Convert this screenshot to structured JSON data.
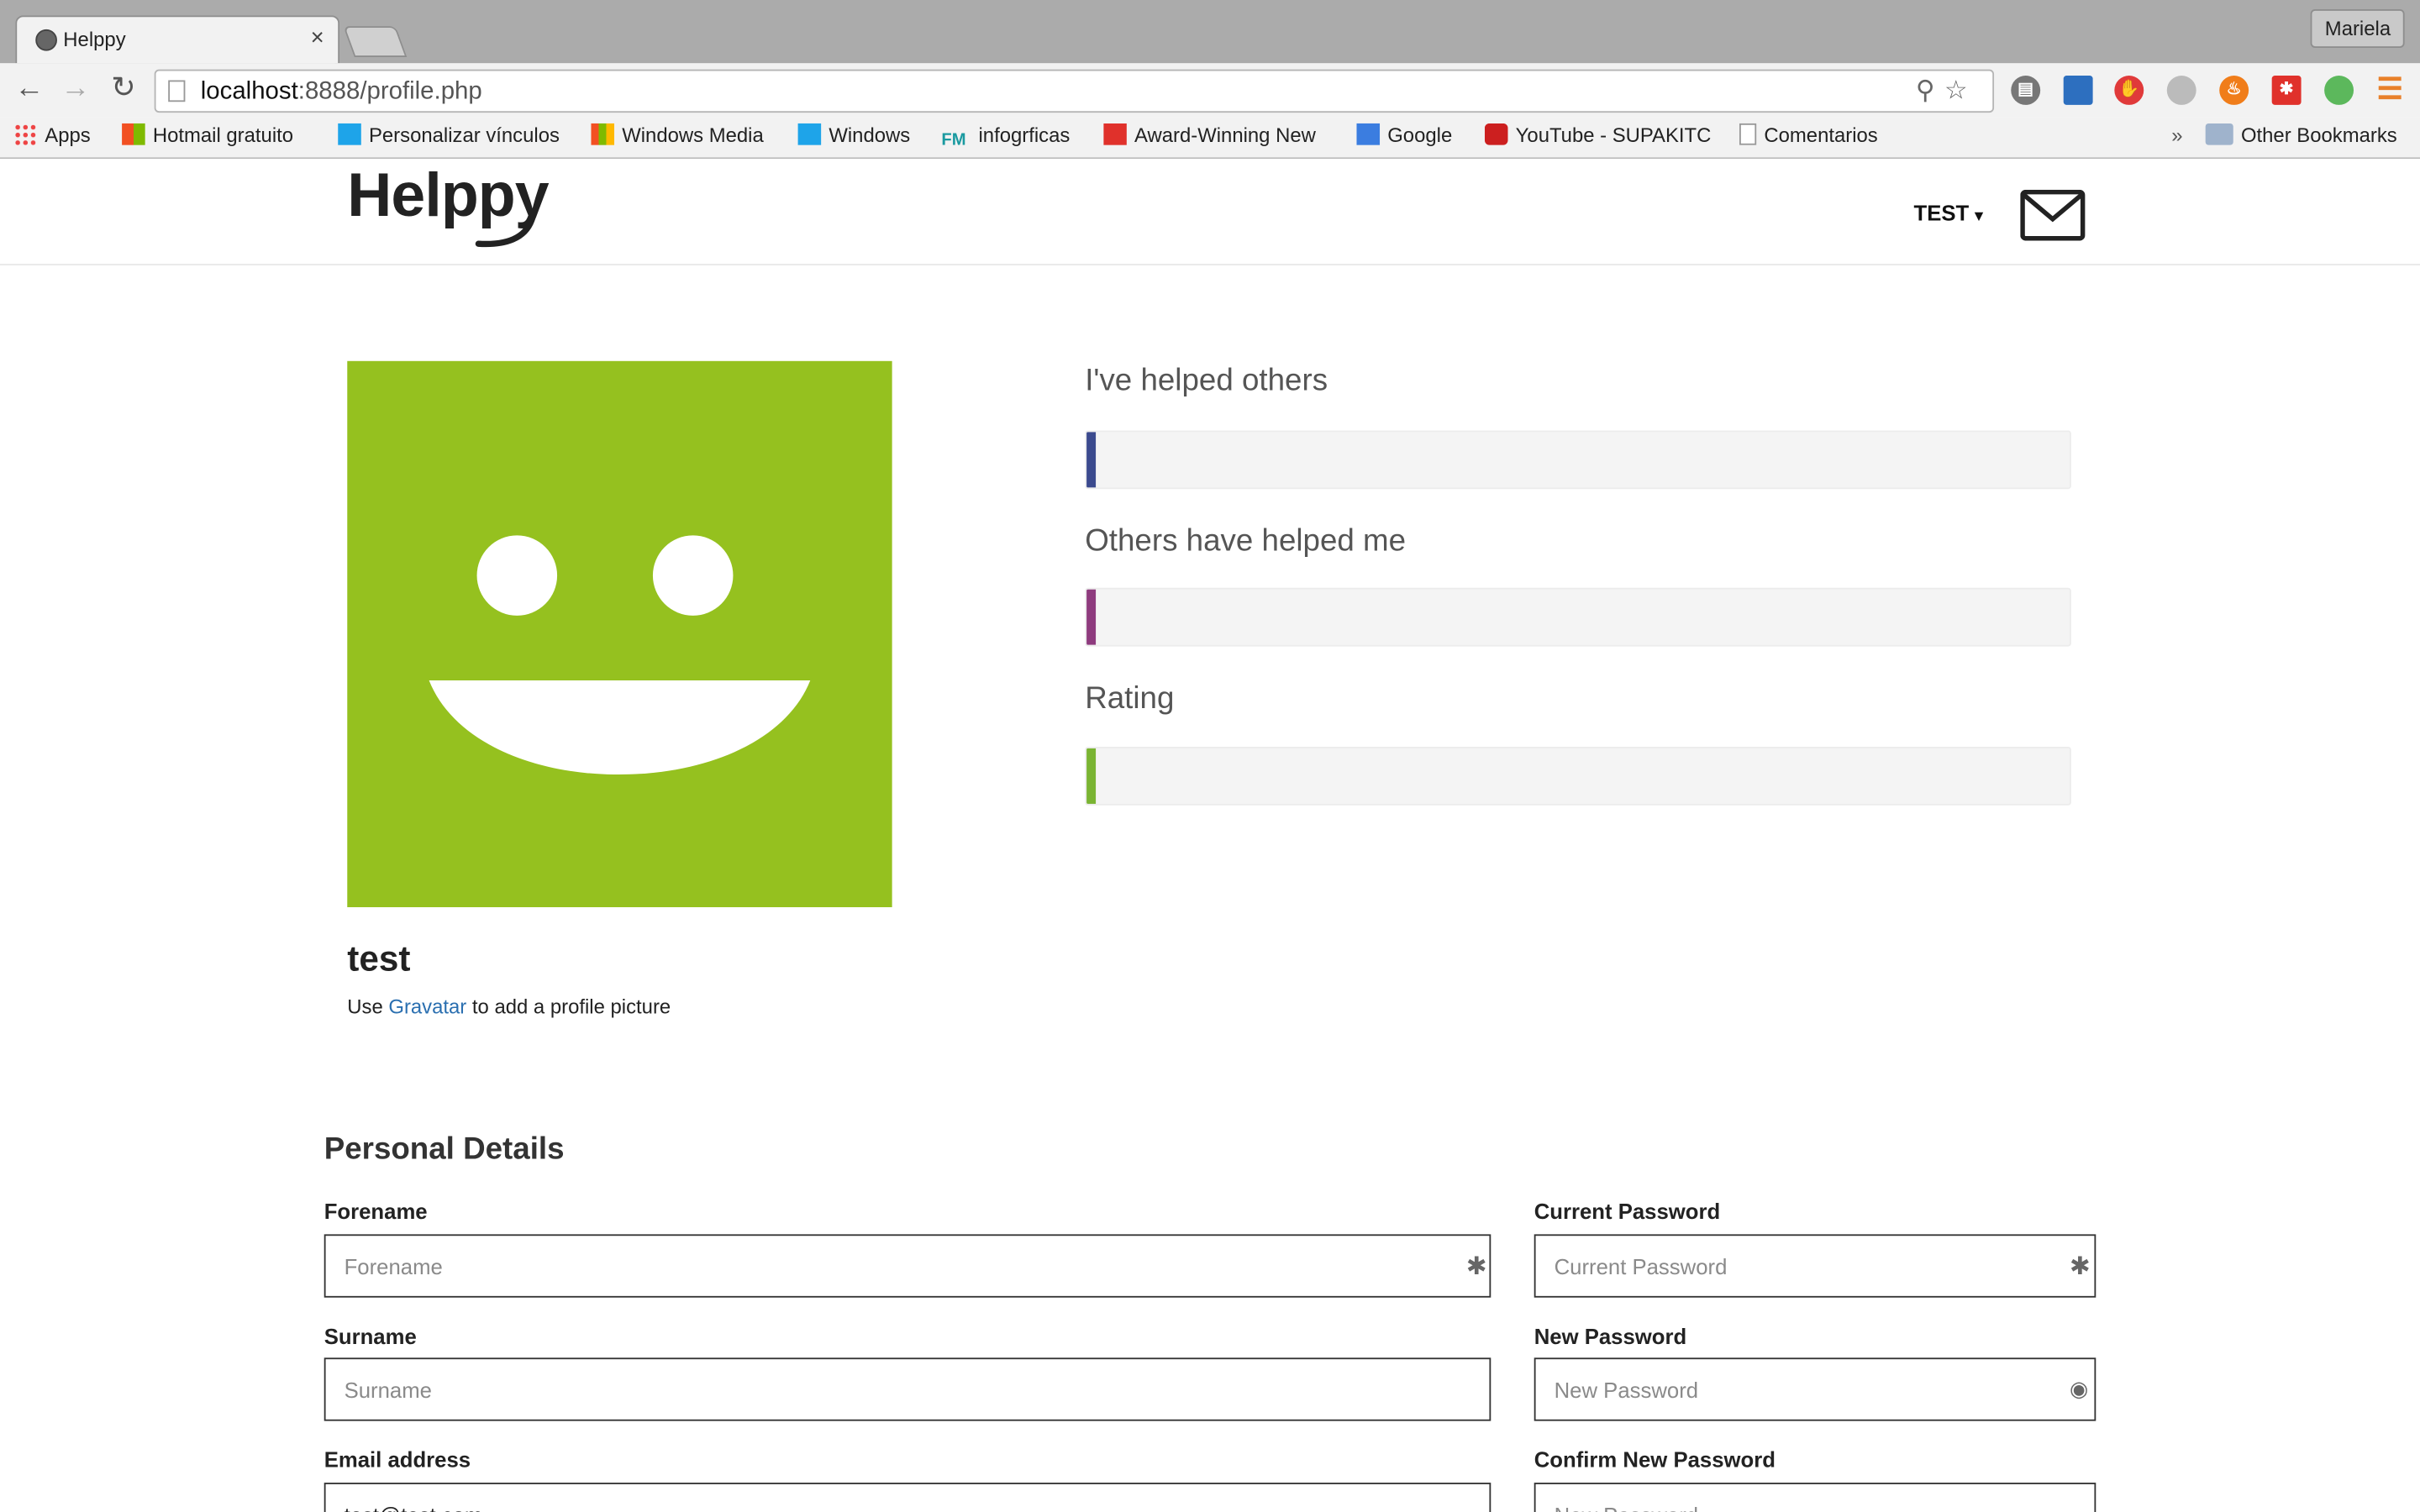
{
  "browser": {
    "tab_title": "Helppy",
    "profile_button": "Mariela",
    "url_host": "localhost",
    "url_rest": ":8888/profile.php",
    "bookmarks": [
      {
        "label": "Apps",
        "icon": "apps-grid-icon"
      },
      {
        "label": "Hotmail gratuito",
        "icon": "windows-icon"
      },
      {
        "label": "Personalizar vínculos",
        "icon": "windows-icon"
      },
      {
        "label": "Windows Media",
        "icon": "windows-icon"
      },
      {
        "label": "Windows",
        "icon": "windows-icon"
      },
      {
        "label": "infogrficas",
        "icon": "fm-icon"
      },
      {
        "label": "Award-Winning New",
        "icon": "s-icon"
      },
      {
        "label": "Google",
        "icon": "google-icon"
      },
      {
        "label": "YouTube - SUPAKITC",
        "icon": "youtube-icon"
      },
      {
        "label": "Comentarios",
        "icon": "page-icon"
      }
    ],
    "overflow_chevron": "»",
    "other_bookmarks": "Other Bookmarks"
  },
  "header": {
    "logo": "Helppy",
    "user_menu": "TEST",
    "caret": "▾"
  },
  "profile": {
    "username": "test",
    "note_prefix": "Use ",
    "note_link": "Gravatar",
    "note_suffix": " to add a profile picture"
  },
  "stats": [
    {
      "label": "I've helped others",
      "value": 0,
      "color": "#3b4a8e"
    },
    {
      "label": "Others have helped me",
      "value": 0,
      "color": "#8e3b7e"
    },
    {
      "label": "Rating",
      "value": 0,
      "color": "#7ab432"
    }
  ],
  "form": {
    "title": "Personal Details",
    "forename": {
      "label": "Forename",
      "placeholder": "Forename"
    },
    "surname": {
      "label": "Surname",
      "placeholder": "Surname"
    },
    "email": {
      "label": "Email address",
      "value": "test@test.com"
    },
    "current_password": {
      "label": "Current Password",
      "placeholder": "Current Password"
    },
    "new_password": {
      "label": "New Password",
      "placeholder": "New Password"
    },
    "confirm_password": {
      "label": "Confirm New Password",
      "placeholder": "New Password"
    },
    "required_mark": "✱"
  },
  "colors": {
    "avatar_bg": "#95c11f",
    "link": "#2a6fb0"
  }
}
